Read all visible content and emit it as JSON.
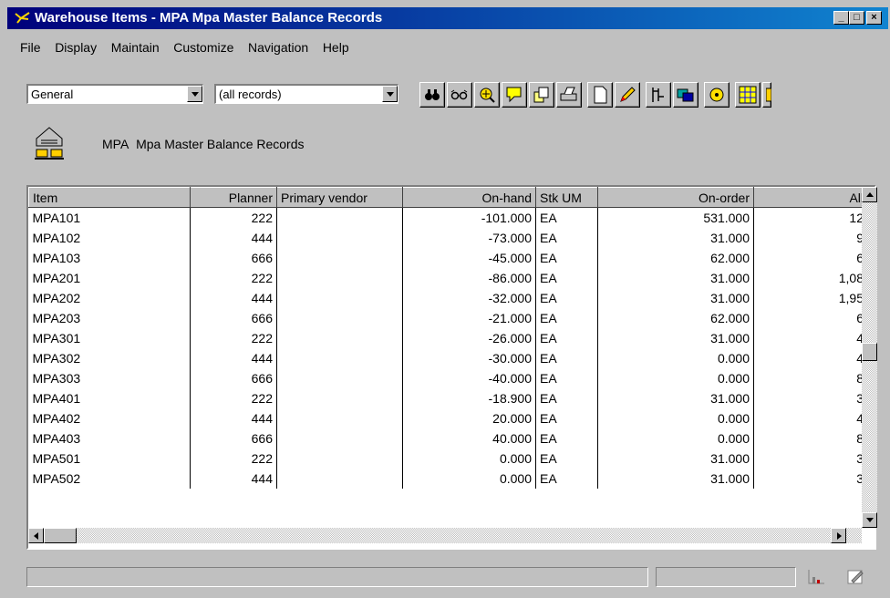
{
  "window": {
    "title": "Warehouse Items - MPA   Mpa Master Balance Records",
    "minimize_label": "_",
    "maximize_label": "□",
    "close_label": "×"
  },
  "menu": [
    "File",
    "Display",
    "Maintain",
    "Customize",
    "Navigation",
    "Help"
  ],
  "filters": {
    "view": "General",
    "records": "(all records)"
  },
  "toolbar": {
    "icons": [
      "binoculars-icon",
      "glasses-icon",
      "filter-icon",
      "note-icon",
      "copy-icon",
      "print-icon",
      "new-document-icon",
      "pencil-icon",
      "tree-icon",
      "window-icon",
      "disk-icon",
      "grid-icon",
      "more-icon"
    ]
  },
  "header": {
    "code": "MPA",
    "description": "Mpa Master Balance Records"
  },
  "table": {
    "columns": [
      "Item",
      "Planner",
      "Primary vendor",
      "On-hand",
      "Stk UM",
      "On-order",
      "All"
    ],
    "rows": [
      [
        "MPA101",
        "222",
        "",
        "-101.000",
        "EA",
        "531.000",
        "12"
      ],
      [
        "MPA102",
        "444",
        "",
        "-73.000",
        "EA",
        "31.000",
        "9"
      ],
      [
        "MPA103",
        "666",
        "",
        "-45.000",
        "EA",
        "62.000",
        "6"
      ],
      [
        "MPA201",
        "222",
        "",
        "-86.000",
        "EA",
        "31.000",
        "1,08"
      ],
      [
        "MPA202",
        "444",
        "",
        "-32.000",
        "EA",
        "31.000",
        "1,95"
      ],
      [
        "MPA203",
        "666",
        "",
        "-21.000",
        "EA",
        "62.000",
        "6"
      ],
      [
        "MPA301",
        "222",
        "",
        "-26.000",
        "EA",
        "31.000",
        "4"
      ],
      [
        "MPA302",
        "444",
        "",
        "-30.000",
        "EA",
        "0.000",
        "4"
      ],
      [
        "MPA303",
        "666",
        "",
        "-40.000",
        "EA",
        "0.000",
        "8"
      ],
      [
        "MPA401",
        "222",
        "",
        "-18.900",
        "EA",
        "31.000",
        "3"
      ],
      [
        "MPA402",
        "444",
        "",
        "20.000",
        "EA",
        "0.000",
        "4"
      ],
      [
        "MPA403",
        "666",
        "",
        "40.000",
        "EA",
        "0.000",
        "8"
      ],
      [
        "MPA501",
        "222",
        "",
        "0.000",
        "EA",
        "31.000",
        "3"
      ],
      [
        "MPA502",
        "444",
        "",
        "0.000",
        "EA",
        "31.000",
        "3"
      ]
    ]
  },
  "status": {
    "left": "",
    "right": ""
  }
}
